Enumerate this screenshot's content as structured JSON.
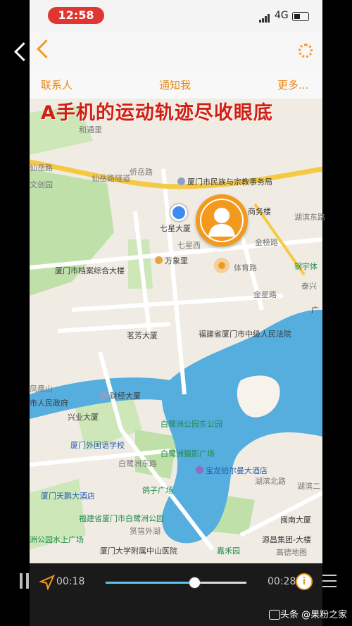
{
  "status_bar": {
    "time": "12:58",
    "network": "4G"
  },
  "menu": {
    "contacts": "联系人",
    "notify": "通知我",
    "more": "更多..."
  },
  "headline": "A手机的运动轨迹尽收眼底",
  "map": {
    "roads": {
      "heping": "和通里",
      "xianyue": "仙岳路",
      "xianyue_tunnel": "仙岳路隧道",
      "qiaoyue": "侨岳路",
      "qixingxi": "七星西",
      "tiyu": "体育路",
      "jinxing": "金星路",
      "jinbang": "金榜路",
      "hubin_east": "湖滨东路",
      "bailuzhou_east": "白鹭洲东路",
      "hubin_north": "湖滨北路",
      "taiqin": "泰兴",
      "huanghe": "湖滨二",
      "wentong": "文创园"
    },
    "pois": {
      "minzu": "厦门市民族与宗教事务局",
      "qixing": "七星大厦",
      "shangwu": "商务楼",
      "wanxiangli": "万象里",
      "archives": "厦门市档案综合大楼",
      "gangyu": "钢宇体",
      "guanghe": "广",
      "mingfang": "茗芳大厦",
      "court": "福建省厦门市中级人民法院",
      "fenghuang": "凤凰山",
      "govt": "市人民政府",
      "caijing": "财经大厦",
      "xingye": "兴业大厦",
      "bailuzhou_park_east": "白鹭洲公园东公园",
      "foreign_school": "厦门外国语学校",
      "photo_plaza": "白鹭洲摄影广场",
      "baolong": "宝龙铂尔曼大酒店",
      "tianpeng": "厦门天鹏大酒店",
      "gezi": "鸽子广场",
      "bailuzhou_park": "福建省厦门市白鹭洲公园",
      "shanghai_square": "洲公园水上广场",
      "yundang": "筼筜外湖",
      "hospital": "厦门大学附属中山医院",
      "jiahe": "嘉禾园",
      "minnan": "闽南大厦",
      "yuanyi": "源昌集团-大楼",
      "gaode": "高德地图"
    }
  },
  "player": {
    "elapsed": "00:18",
    "total": "00:28",
    "progress": 0.63,
    "info": "i"
  },
  "watermark": "头条 @果粉之家",
  "colors": {
    "accent": "#f39a1e",
    "headline": "#d11f14",
    "water": "#56aedf",
    "road_major": "#f5c942",
    "park": "#bfe0a8"
  }
}
